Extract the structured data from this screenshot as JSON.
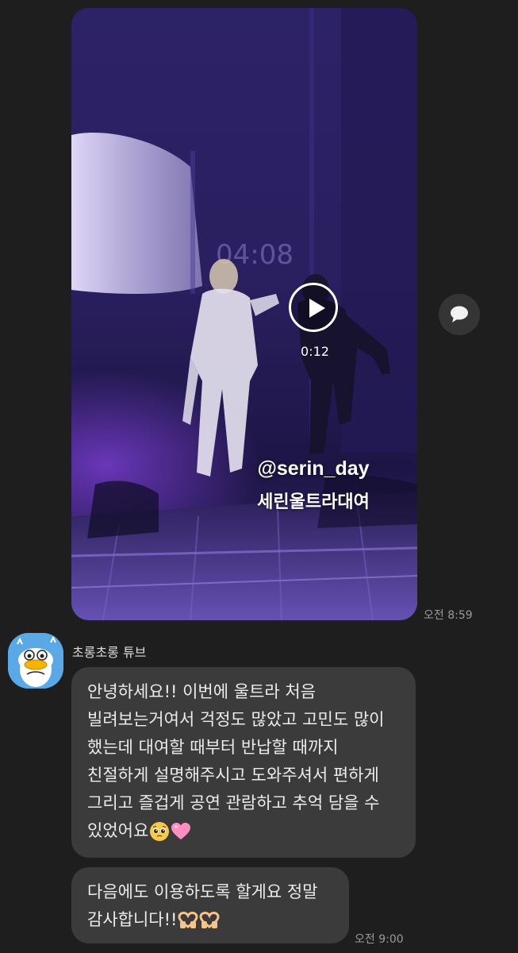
{
  "video": {
    "duration": "0:12",
    "watermark_handle": "@serin_day",
    "watermark_name": "세린울트라대여",
    "sent_time": "오전 8:59"
  },
  "sender": {
    "name": "초롱초롱 튜브"
  },
  "messages": [
    {
      "lines": [
        "안녕하세요!! 이번에 울트라 처음",
        "빌려보는거여서 걱정도 많았고 고민도 많이",
        "했는데 대여할 때부터 반납할 때까지",
        "친절하게 설명해주시고 도와주셔서 편하게",
        "그리고 즐겁게 공연 관람하고 추억 담을 수",
        "있었어요"
      ],
      "emojis": [
        "pleading-face-emoji",
        "pink-heart-emoji"
      ]
    },
    {
      "lines": [
        "다음에도 이용하도록 할게요 정말",
        "감사합니다!!"
      ],
      "emojis": [
        "heart-hands-emoji",
        "heart-hands-emoji"
      ]
    }
  ],
  "last_time": "오전 9:00",
  "icons": {
    "play": "play-icon",
    "comment": "comment-icon"
  },
  "colors": {
    "background": "#1e1e1e",
    "bubble": "#3b3b3b",
    "time_text": "#9a9a9a"
  }
}
